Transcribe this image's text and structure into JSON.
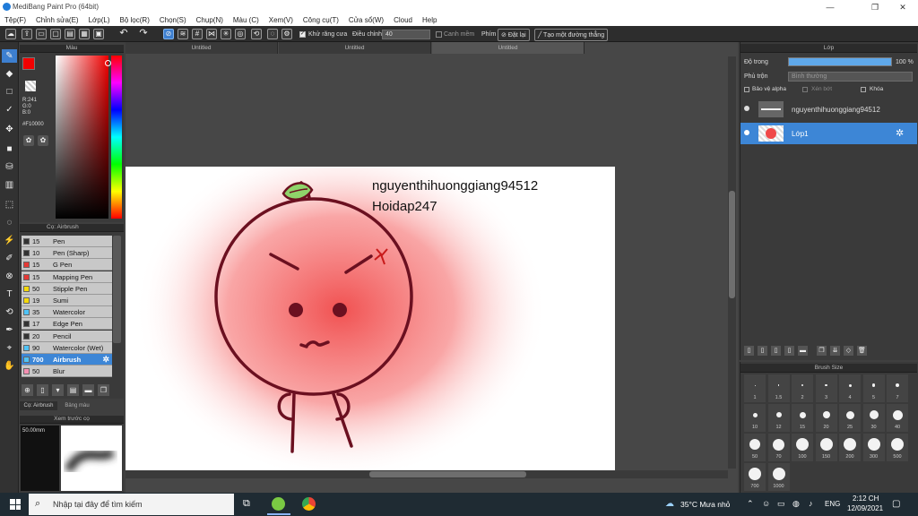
{
  "window": {
    "title": "MediBang Paint Pro (64bit)",
    "minimize": "—",
    "maximize": "❐",
    "close": "✕"
  },
  "menu": [
    "Tệp(F)",
    "Chỉnh sửa(E)",
    "Lớp(L)",
    "Bộ lọc(R)",
    "Chọn(S)",
    "Chụp(N)",
    "Màu (C)",
    "Xem(V)",
    "Công cụ(T)",
    "Cửa sổ(W)",
    "Cloud",
    "Help"
  ],
  "toolbar": {
    "antialias_label": "Khử răng cưa",
    "adjust_label": "Điều chỉnh",
    "adjust_value": "40",
    "smooth_label": "Canh mềm",
    "keys_label": "Phím",
    "reset_label": "Đặt lại",
    "straight_label": "Tạo một đường thẳng"
  },
  "tabs": [
    "Untitled",
    "Untitled",
    "Untitled"
  ],
  "color_panel": {
    "title": "Màu",
    "r": "R:241",
    "g": "G:0",
    "b": "B:0",
    "hex": "#F10000",
    "fg_color": "#f10000"
  },
  "brush_panel": {
    "title": "Cọ: Airbrush",
    "items": [
      {
        "size": "15",
        "name": "Pen",
        "color": "#333333"
      },
      {
        "size": "10",
        "name": "Pen (Sharp)",
        "color": "#333333"
      },
      {
        "size": "15",
        "name": "G Pen",
        "color": "#e53935"
      },
      {
        "size": "15",
        "name": "Mapping Pen",
        "color": "#e53935"
      },
      {
        "size": "50",
        "name": "Stipple Pen",
        "color": "#f5d90a"
      },
      {
        "size": "19",
        "name": "Sumi",
        "color": "#f5d90a"
      },
      {
        "size": "35",
        "name": "Watercolor",
        "color": "#4fc3f7"
      },
      {
        "size": "17",
        "name": "Edge Pen",
        "color": "#333333"
      },
      {
        "size": "20",
        "name": "Pencil",
        "color": "#333333"
      },
      {
        "size": "90",
        "name": "Watercolor (Wet)",
        "color": "#4fc3f7"
      },
      {
        "size": "700",
        "name": "Airbrush",
        "color": "#4fc3f7"
      },
      {
        "size": "50",
        "name": "Blur",
        "color": "#f48fb1"
      }
    ]
  },
  "lower_tabs": [
    "Cọ: Airbrush",
    "Bảng màu"
  ],
  "preview": {
    "title": "Xem trước cọ",
    "size": "50.00mm"
  },
  "canvas": {
    "line1": "nguyenthihuonggiang94512",
    "line2": "Hoidap247"
  },
  "layer_panel": {
    "title": "Lớp",
    "opacity_label": "Độ trong",
    "opacity_value": "100 %",
    "opacity_fraction": 1.0,
    "blend_label": "Phủ trộn",
    "blend_value": "Bình thường",
    "protect_alpha": "Bảo vệ alpha",
    "clipping": "Xén bớt",
    "lock": "Khóa",
    "layers": [
      {
        "name": "nguyenthihuonggiang94512"
      },
      {
        "name": "Lớp1"
      }
    ]
  },
  "size_panel": {
    "title": "Brush Size",
    "sizes": [
      "1",
      "1.5",
      "2",
      "3",
      "4",
      "5",
      "7",
      "10",
      "12",
      "15",
      "20",
      "25",
      "30",
      "40",
      "50",
      "70",
      "100",
      "150",
      "200",
      "300",
      "500",
      "700",
      "1000"
    ]
  },
  "taskbar": {
    "search": "Nhập tại đây để tìm kiếm",
    "weather": "35°C  Mưa nhỏ",
    "lang": "ENG",
    "time": "2:12 CH",
    "date": "12/09/2021"
  }
}
